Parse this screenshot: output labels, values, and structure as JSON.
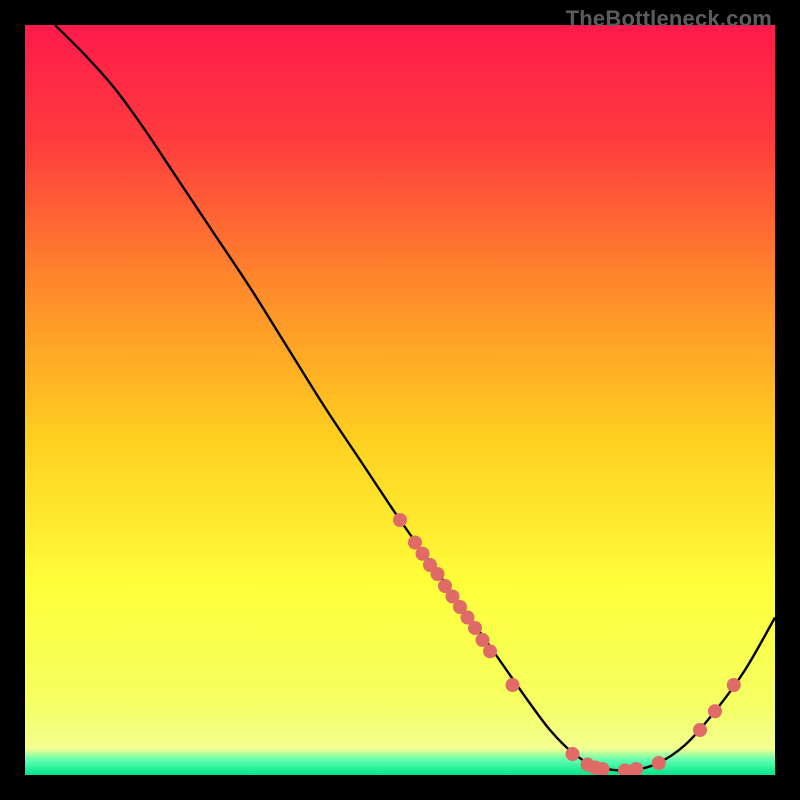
{
  "attribution": "TheBottleneck.com",
  "chart_data": {
    "type": "line",
    "title": "",
    "xlabel": "",
    "ylabel": "",
    "xlim": [
      0,
      100
    ],
    "ylim": [
      0,
      100
    ],
    "grid": false,
    "legend": false,
    "gradient_stops": [
      {
        "offset": 0.0,
        "color": "#ff1a4b"
      },
      {
        "offset": 0.15,
        "color": "#ff3a3e"
      },
      {
        "offset": 0.35,
        "color": "#ff8a2a"
      },
      {
        "offset": 0.55,
        "color": "#ffcf20"
      },
      {
        "offset": 0.75,
        "color": "#ffff3a"
      },
      {
        "offset": 0.9,
        "color": "#f5ff60"
      },
      {
        "offset": 0.965,
        "color": "#f2ff90"
      },
      {
        "offset": 0.98,
        "color": "#60ffb0"
      },
      {
        "offset": 1.0,
        "color": "#00e58a"
      }
    ],
    "series": [
      {
        "name": "bottleneck-curve",
        "color": "#000000",
        "x": [
          4,
          8,
          12,
          16,
          20,
          25,
          30,
          35,
          40,
          45,
          50,
          55,
          60,
          63.5,
          67,
          70,
          73,
          76,
          80,
          84,
          88,
          92,
          96,
          100
        ],
        "y": [
          100,
          96,
          91.5,
          86,
          80,
          72.5,
          65,
          57,
          49,
          41.5,
          34,
          27,
          20,
          15,
          10,
          6,
          3,
          1.2,
          0.6,
          1.4,
          4,
          8.5,
          14,
          21
        ]
      }
    ],
    "scatter": [
      {
        "name": "curve-markers",
        "color": "#e06a66",
        "radius_px": 7,
        "points": [
          {
            "x": 50,
            "y": 34
          },
          {
            "x": 52,
            "y": 31
          },
          {
            "x": 53,
            "y": 29.5
          },
          {
            "x": 54,
            "y": 28
          },
          {
            "x": 55,
            "y": 26.8
          },
          {
            "x": 56,
            "y": 25.2
          },
          {
            "x": 57,
            "y": 23.8
          },
          {
            "x": 58,
            "y": 22.4
          },
          {
            "x": 59,
            "y": 21
          },
          {
            "x": 60,
            "y": 19.6
          },
          {
            "x": 61,
            "y": 18
          },
          {
            "x": 62,
            "y": 16.5
          },
          {
            "x": 65,
            "y": 12
          },
          {
            "x": 73,
            "y": 2.8
          },
          {
            "x": 75,
            "y": 1.4
          },
          {
            "x": 76,
            "y": 1.0
          },
          {
            "x": 77,
            "y": 0.8
          },
          {
            "x": 80,
            "y": 0.6
          },
          {
            "x": 81.5,
            "y": 0.8
          },
          {
            "x": 84.5,
            "y": 1.6
          },
          {
            "x": 90,
            "y": 6
          },
          {
            "x": 92,
            "y": 8.5
          },
          {
            "x": 94.5,
            "y": 12
          }
        ]
      }
    ]
  }
}
